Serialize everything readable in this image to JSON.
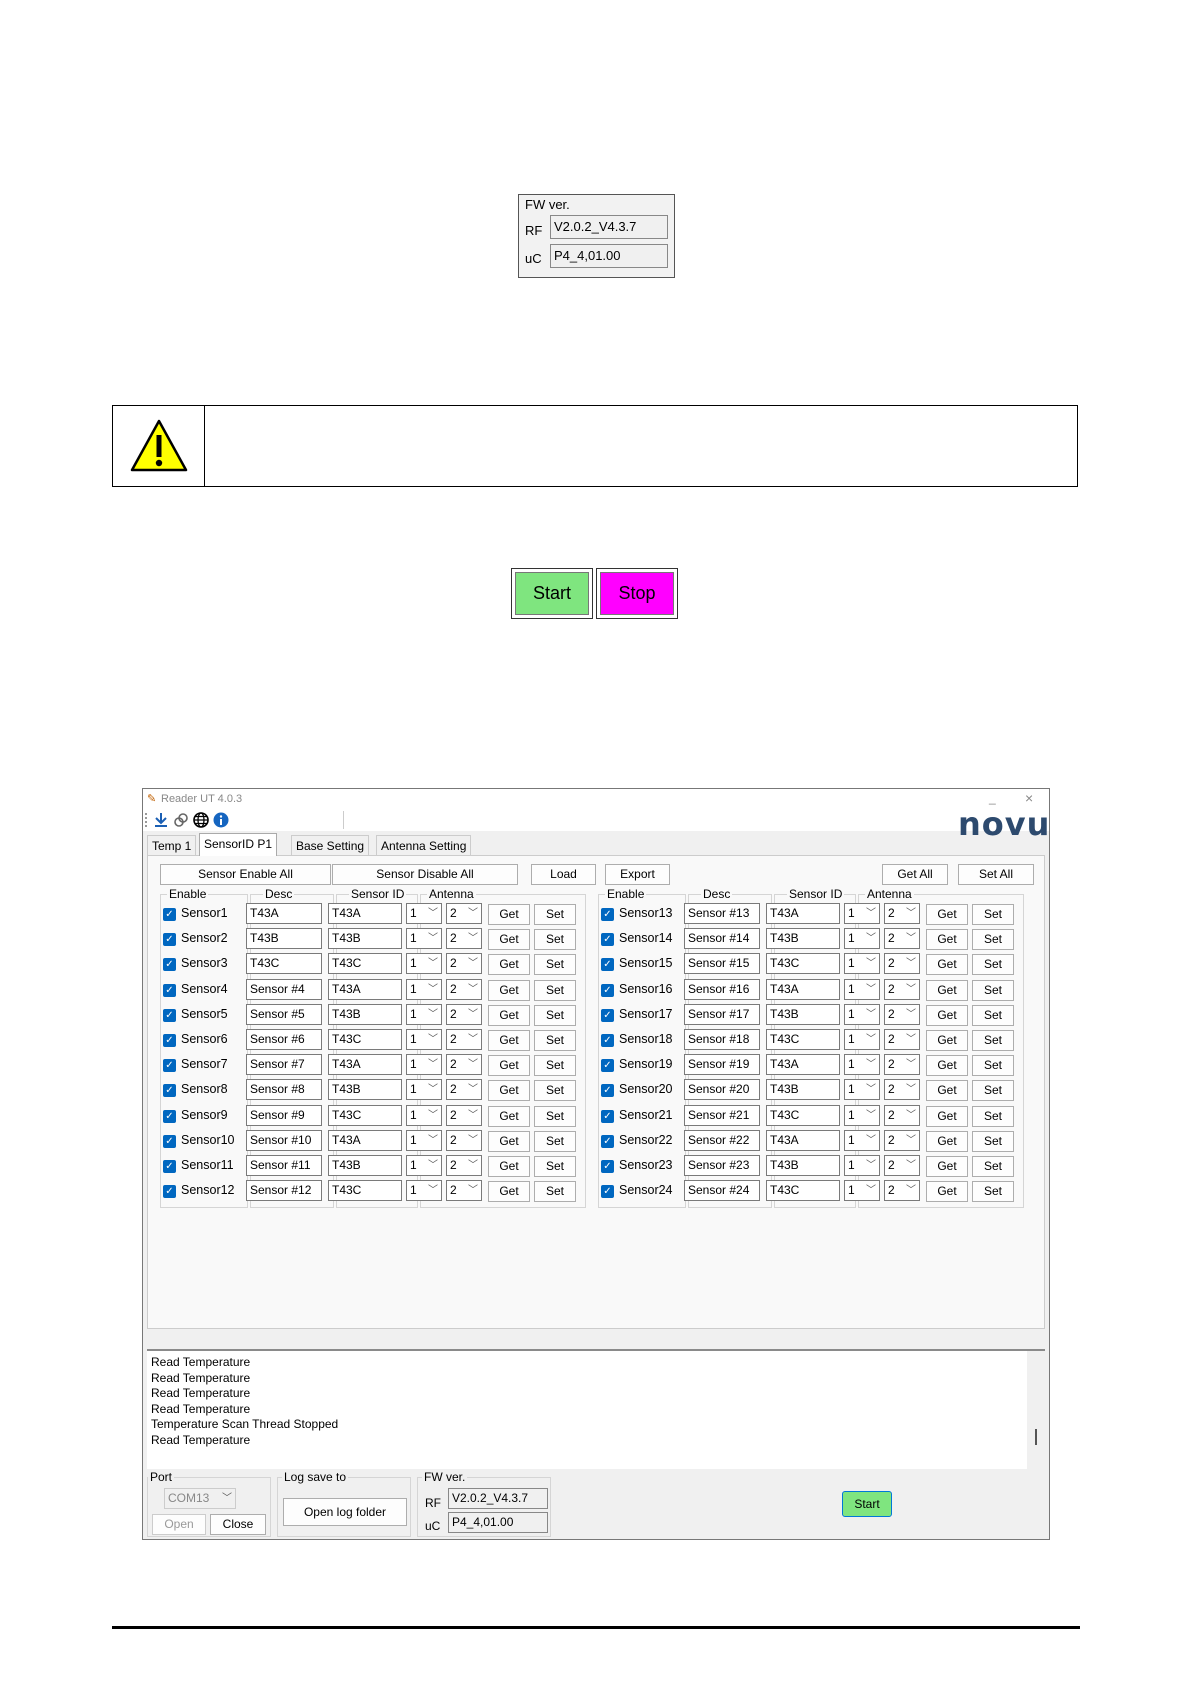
{
  "fw_box": {
    "legend": "FW ver.",
    "rf_label": "RF",
    "rf_value": "V2.0.2_V4.3.7",
    "uc_label": "uC",
    "uc_value": "P4_4,01.00"
  },
  "buttons_large": {
    "start": "Start",
    "stop": "Stop",
    "start_color": "#7fe57f",
    "stop_color": "#ff00ff"
  },
  "window": {
    "title": "Reader UT 4.0.3",
    "minimize": "_",
    "close": "×",
    "logo": "novus",
    "logo_color": "#2d4a6e",
    "toolbar_icons": [
      "download-icon",
      "link-icon",
      "globe-icon",
      "info-icon"
    ],
    "tabs": [
      "Temp 1",
      "SensorID P1",
      "Base Setting",
      "Antenna Setting"
    ],
    "active_tab": "SensorID P1",
    "top_buttons": {
      "enable_all": "Sensor Enable All",
      "disable_all": "Sensor Disable All",
      "load": "Load",
      "export": "Export",
      "get_all": "Get All",
      "set_all": "Set All"
    },
    "group_titles": {
      "enable": "Enable",
      "desc": "Desc",
      "sensor_id": "Sensor ID",
      "antenna": "Antenna"
    },
    "get_label": "Get",
    "set_label": "Set",
    "sensors": [
      {
        "name": "Sensor1",
        "desc": "T43A",
        "id": "T43A",
        "a1": "1",
        "a2": "2",
        "enabled": true
      },
      {
        "name": "Sensor2",
        "desc": "T43B",
        "id": "T43B",
        "a1": "1",
        "a2": "2",
        "enabled": true
      },
      {
        "name": "Sensor3",
        "desc": "T43C",
        "id": "T43C",
        "a1": "1",
        "a2": "2",
        "enabled": true
      },
      {
        "name": "Sensor4",
        "desc": "Sensor #4",
        "id": "T43A",
        "a1": "1",
        "a2": "2",
        "enabled": true
      },
      {
        "name": "Sensor5",
        "desc": "Sensor #5",
        "id": "T43B",
        "a1": "1",
        "a2": "2",
        "enabled": true
      },
      {
        "name": "Sensor6",
        "desc": "Sensor #6",
        "id": "T43C",
        "a1": "1",
        "a2": "2",
        "enabled": true
      },
      {
        "name": "Sensor7",
        "desc": "Sensor #7",
        "id": "T43A",
        "a1": "1",
        "a2": "2",
        "enabled": true
      },
      {
        "name": "Sensor8",
        "desc": "Sensor #8",
        "id": "T43B",
        "a1": "1",
        "a2": "2",
        "enabled": true
      },
      {
        "name": "Sensor9",
        "desc": "Sensor #9",
        "id": "T43C",
        "a1": "1",
        "a2": "2",
        "enabled": true
      },
      {
        "name": "Sensor10",
        "desc": "Sensor #10",
        "id": "T43A",
        "a1": "1",
        "a2": "2",
        "enabled": true
      },
      {
        "name": "Sensor11",
        "desc": "Sensor #11",
        "id": "T43B",
        "a1": "1",
        "a2": "2",
        "enabled": true
      },
      {
        "name": "Sensor12",
        "desc": "Sensor #12",
        "id": "T43C",
        "a1": "1",
        "a2": "2",
        "enabled": true
      },
      {
        "name": "Sensor13",
        "desc": "Sensor #13",
        "id": "T43A",
        "a1": "1",
        "a2": "2",
        "enabled": true
      },
      {
        "name": "Sensor14",
        "desc": "Sensor #14",
        "id": "T43B",
        "a1": "1",
        "a2": "2",
        "enabled": true
      },
      {
        "name": "Sensor15",
        "desc": "Sensor #15",
        "id": "T43C",
        "a1": "1",
        "a2": "2",
        "enabled": true
      },
      {
        "name": "Sensor16",
        "desc": "Sensor #16",
        "id": "T43A",
        "a1": "1",
        "a2": "2",
        "enabled": true
      },
      {
        "name": "Sensor17",
        "desc": "Sensor #17",
        "id": "T43B",
        "a1": "1",
        "a2": "2",
        "enabled": true
      },
      {
        "name": "Sensor18",
        "desc": "Sensor #18",
        "id": "T43C",
        "a1": "1",
        "a2": "2",
        "enabled": true
      },
      {
        "name": "Sensor19",
        "desc": "Sensor #19",
        "id": "T43A",
        "a1": "1",
        "a2": "2",
        "enabled": true
      },
      {
        "name": "Sensor20",
        "desc": "Sensor #20",
        "id": "T43B",
        "a1": "1",
        "a2": "2",
        "enabled": true
      },
      {
        "name": "Sensor21",
        "desc": "Sensor #21",
        "id": "T43C",
        "a1": "1",
        "a2": "2",
        "enabled": true
      },
      {
        "name": "Sensor22",
        "desc": "Sensor #22",
        "id": "T43A",
        "a1": "1",
        "a2": "2",
        "enabled": true
      },
      {
        "name": "Sensor23",
        "desc": "Sensor #23",
        "id": "T43B",
        "a1": "1",
        "a2": "2",
        "enabled": true
      },
      {
        "name": "Sensor24",
        "desc": "Sensor #24",
        "id": "T43C",
        "a1": "1",
        "a2": "2",
        "enabled": true
      }
    ],
    "log_lines": [
      "Read Temperature",
      "Read Temperature",
      "Read Temperature",
      "Read Temperature",
      "Temperature Scan Thread Stopped",
      "Read Temperature"
    ],
    "bottom": {
      "port_title": "Port",
      "port_value": "COM13",
      "open": "Open",
      "close": "Close",
      "log_title": "Log save to",
      "open_log": "Open log folder",
      "fw_title": "FW ver.",
      "rf_label": "RF",
      "rf_value": "V2.0.2_V4.3.7",
      "uc_label": "uC",
      "uc_value": "P4_4,01.00",
      "start": "Start"
    }
  }
}
